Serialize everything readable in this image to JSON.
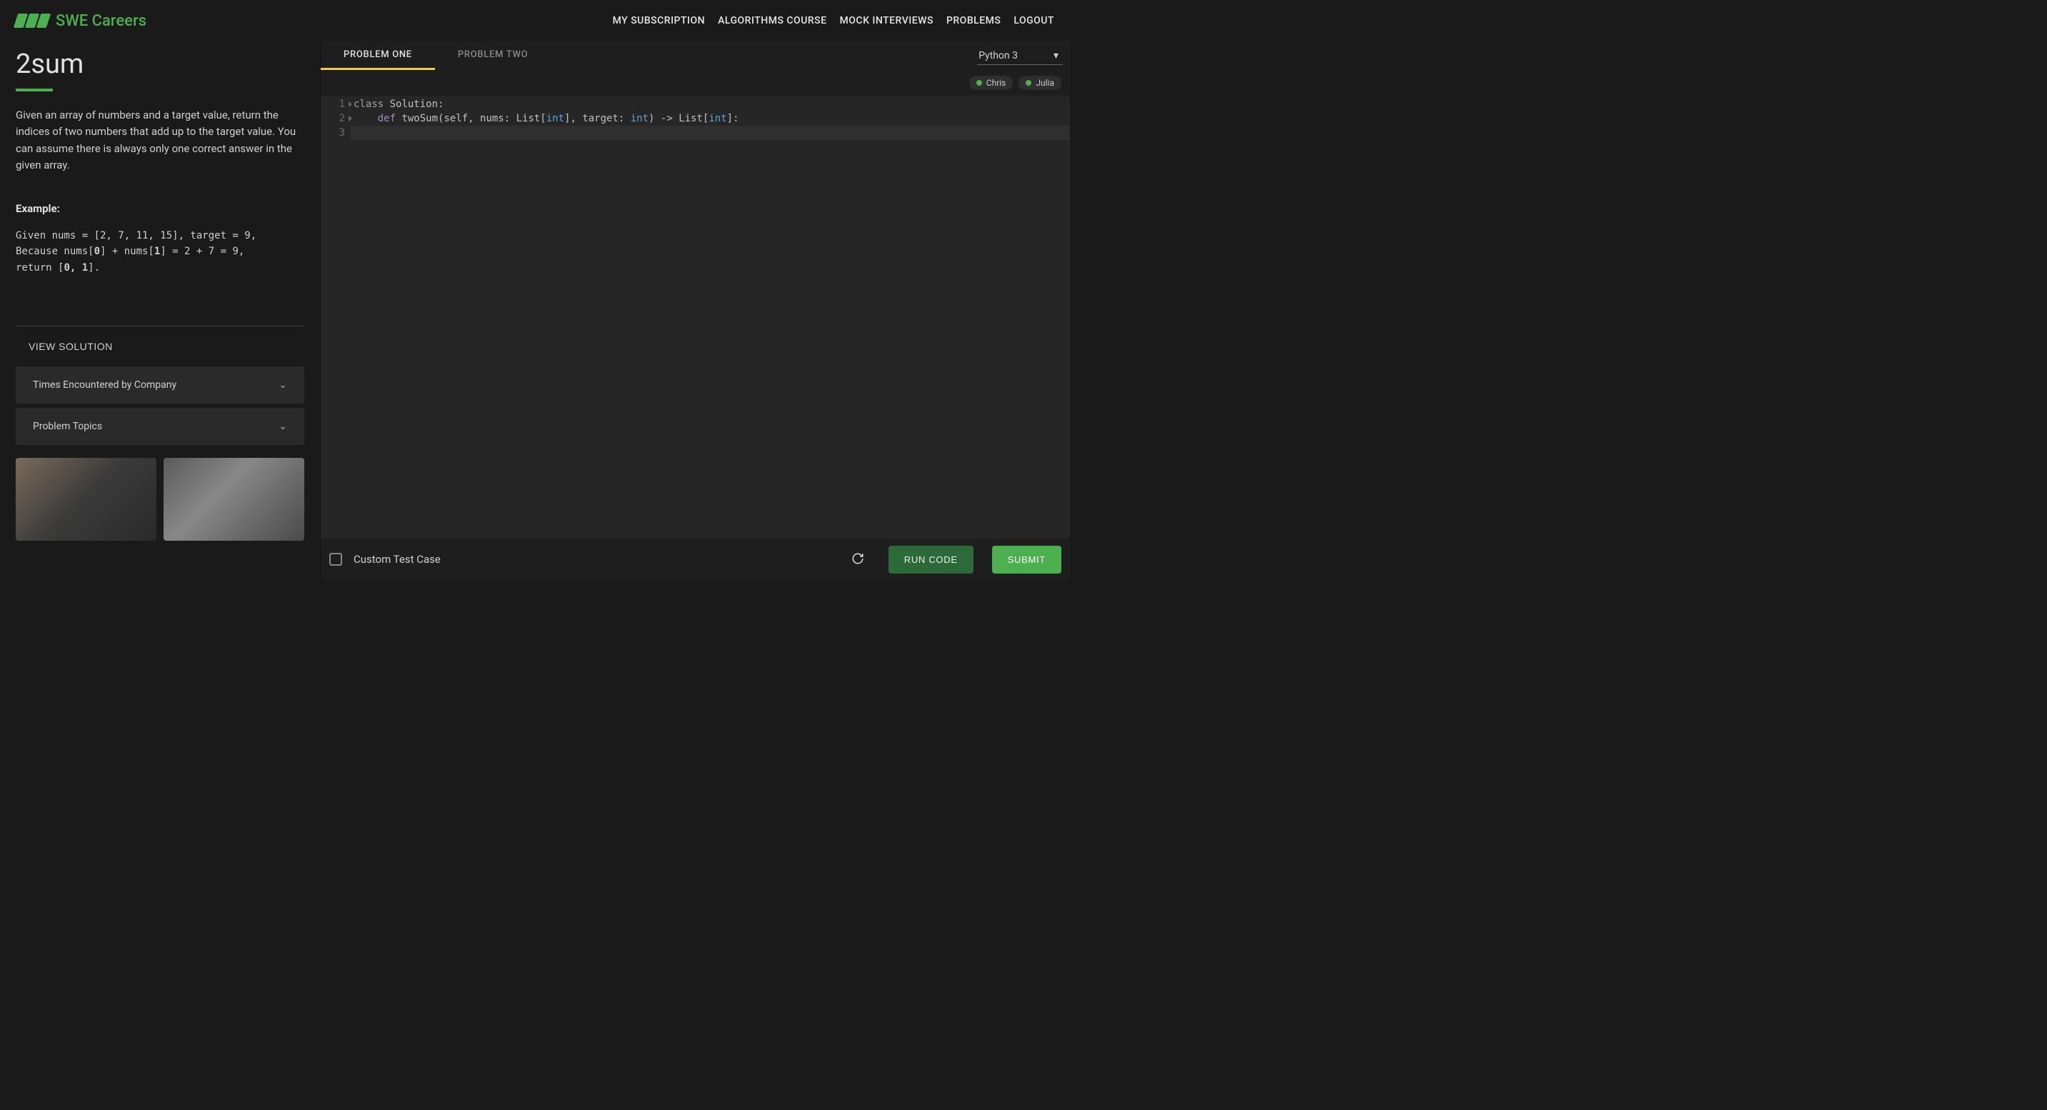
{
  "brand": "SWE Careers",
  "nav": [
    "MY SUBSCRIPTION",
    "ALGORITHMS COURSE",
    "MOCK INTERVIEWS",
    "PROBLEMS",
    "LOGOUT"
  ],
  "problem": {
    "title": "2sum",
    "description": "Given an array of numbers and a target value, return the indices of two numbers that add up to the target value. You can assume there is always only one correct answer in the given array.",
    "example_label": "Example:",
    "example_line1_pre": "Given nums = [2, 7, 11, 15], target = 9,",
    "example_line2_a": "Because nums[",
    "example_line2_b": "0",
    "example_line2_c": "] + nums[",
    "example_line2_d": "1",
    "example_line2_e": "] = 2 + 7 = 9,",
    "example_line3_a": "return [",
    "example_line3_b": "0, 1",
    "example_line3_c": "].",
    "view_solution": "VIEW SOLUTION",
    "accordion1": "Times Encountered by Company",
    "accordion2": "Problem Topics"
  },
  "tabs": {
    "one": "PROBLEM ONE",
    "two": "PROBLEM TWO"
  },
  "language": "Python 3",
  "users": {
    "a": "Chris",
    "b": "Julia"
  },
  "code": {
    "l1_a": "class",
    "l1_b": " Solution:",
    "l2_a": "    def",
    "l2_b": " twoSum(self, nums: List[",
    "l2_c": "int",
    "l2_d": "], target: ",
    "l2_e": "int",
    "l2_f": ") -> List[",
    "l2_g": "int",
    "l2_h": "]:",
    "l3": "        "
  },
  "bottom": {
    "custom": "Custom Test Case",
    "run": "RUN CODE",
    "submit": "SUBMIT"
  }
}
